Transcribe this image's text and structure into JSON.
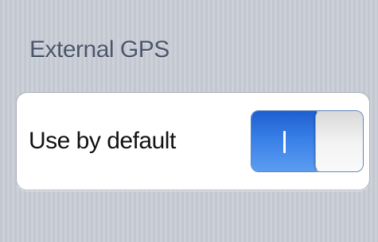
{
  "section": {
    "header": "External GPS"
  },
  "setting": {
    "label": "Use by default",
    "state": "on",
    "accent_color": "#3b82e9"
  }
}
